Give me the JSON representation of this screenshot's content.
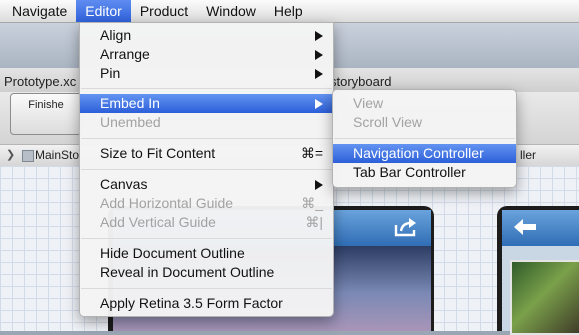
{
  "menubar": {
    "items": [
      "Navigate",
      "Editor",
      "Product",
      "Window",
      "Help"
    ],
    "active": "Editor"
  },
  "window": {
    "title_left": "Prototype.xc",
    "title_right": "storyboard",
    "finish_label": "Finishe",
    "jumpbar_file": "MainSto",
    "jumpbar_right": "ller"
  },
  "editor_menu": {
    "align": "Align",
    "arrange": "Arrange",
    "pin": "Pin",
    "embed_in": "Embed In",
    "unembed": "Unembed",
    "size_to_fit": "Size to Fit Content",
    "size_to_fit_shortcut": "⌘=",
    "canvas": "Canvas",
    "add_h_guide": "Add Horizontal Guide",
    "add_h_guide_shortcut": "⌘_",
    "add_v_guide": "Add Vertical Guide",
    "add_v_guide_shortcut": "⌘|",
    "hide_outline": "Hide Document Outline",
    "reveal_outline": "Reveal in Document Outline",
    "apply_retina": "Apply Retina 3.5 Form Factor"
  },
  "embed_submenu": {
    "view": "View",
    "scroll_view": "Scroll View",
    "navigation_controller": "Navigation Controller",
    "tab_bar_controller": "Tab Bar Controller"
  },
  "icons": {
    "share": "share-icon",
    "back": "back-arrow-icon",
    "disclosure": "chevron-right-icon"
  },
  "colors": {
    "highlight": "#2c5fd9",
    "nav_bar": "#2f6db5"
  }
}
